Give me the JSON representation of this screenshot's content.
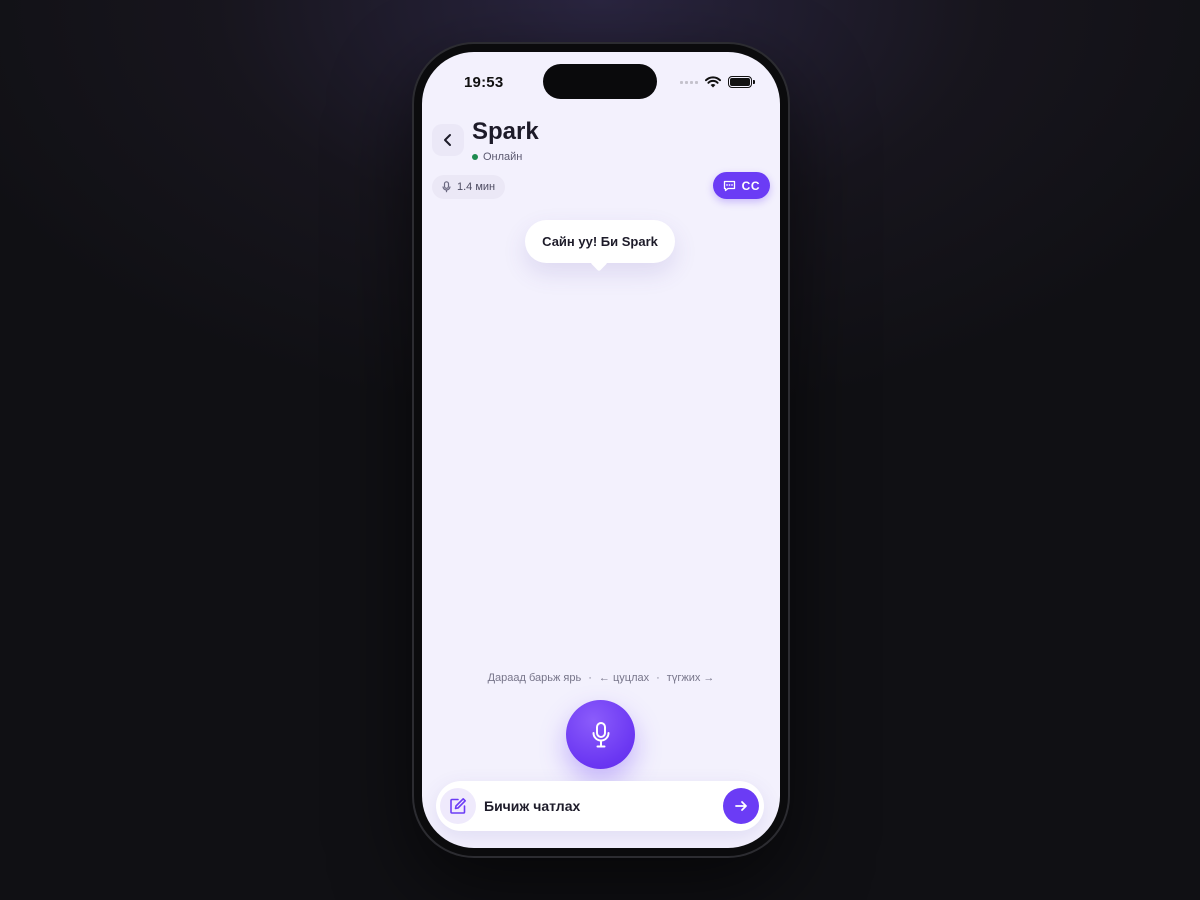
{
  "status_bar": {
    "time": "19:53"
  },
  "header": {
    "title": "Spark",
    "presence": "Онлайн",
    "presence_color": "#1d8a4f"
  },
  "toolbar": {
    "duration_icon": "mic-icon",
    "duration": "1.4 мин",
    "cc_icon": "caption-icon",
    "cc_label": "CC"
  },
  "conversation": {
    "greeting": "Сайн уу! Би Spark"
  },
  "controls": {
    "hint_hold": "Дараад барьж ярь",
    "hint_separator_1": "·",
    "hint_cancel": "← цуцлах",
    "hint_separator_2": "·",
    "hint_send": "түгжих →",
    "mic_icon": "mic-icon"
  },
  "composer": {
    "icon": "compose-icon",
    "label": "Бичиж чатлах",
    "send_icon": "arrow-right-icon"
  },
  "colors": {
    "accent": "#6b3cf5",
    "screen_bg": "#f3f1fd"
  }
}
